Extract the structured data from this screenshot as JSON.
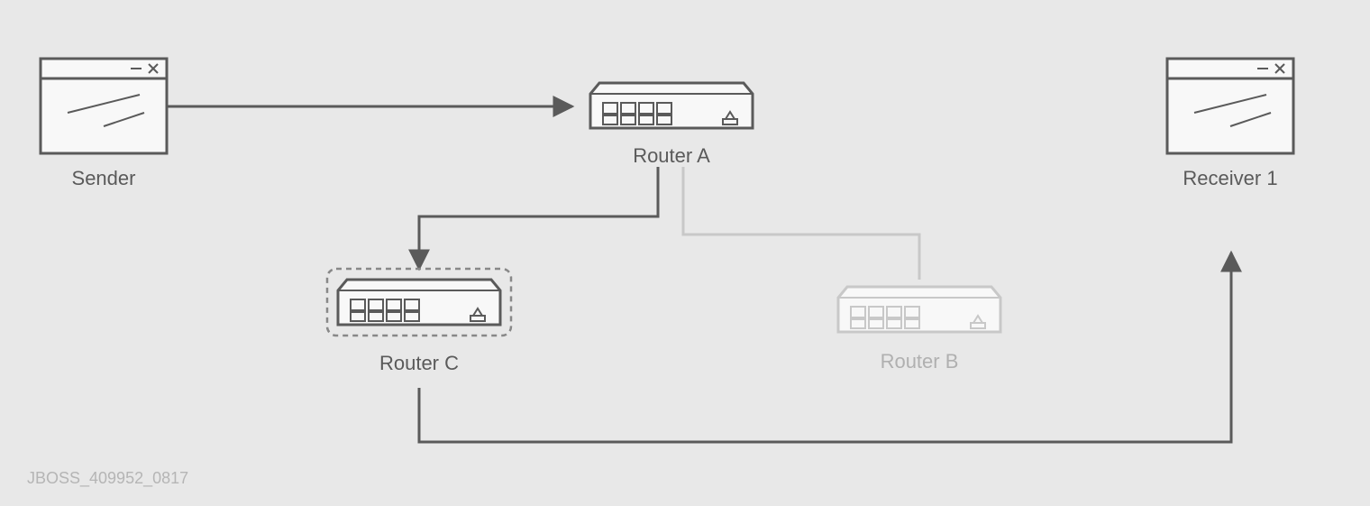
{
  "labels": {
    "sender": "Sender",
    "routerA": "Router A",
    "routerB": "Router B",
    "routerC": "Router C",
    "receiver1": "Receiver 1"
  },
  "footer": "JBOSS_409952_0817",
  "colors": {
    "dark": "#5a5a5a",
    "light": "#c8c8c8",
    "bg": "#e8e8e8",
    "white": "#f8f8f8"
  }
}
